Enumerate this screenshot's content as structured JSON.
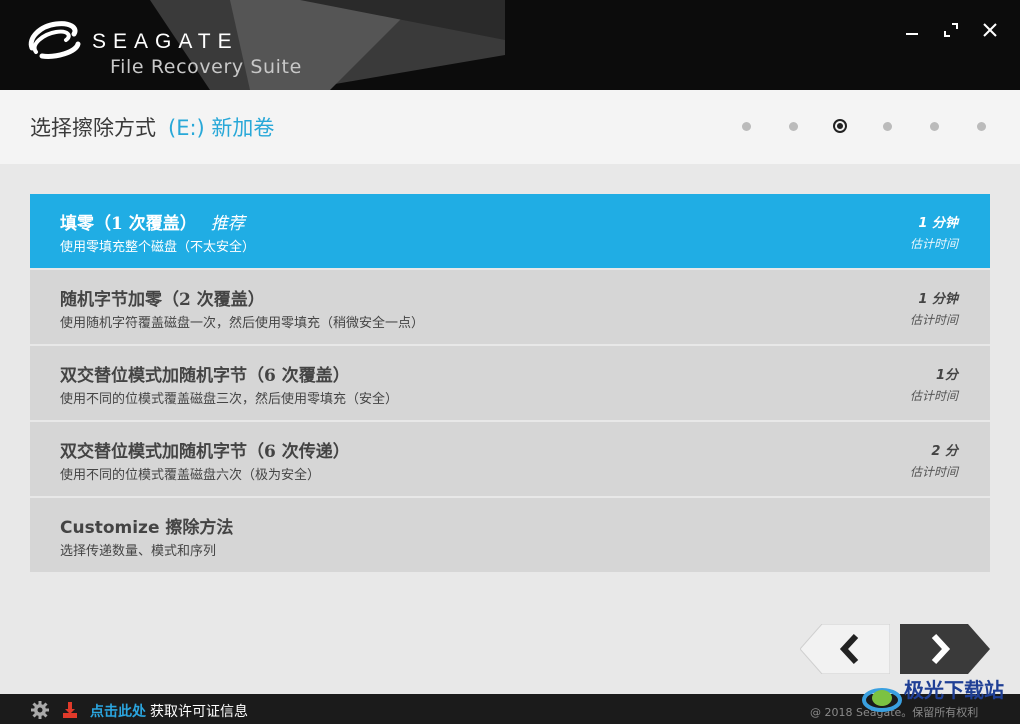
{
  "header": {
    "brand": "SEAGATE",
    "product": "File Recovery Suite"
  },
  "window_controls": [
    "minimize-icon",
    "maximize-icon",
    "close-icon"
  ],
  "stepbar": {
    "title": "选择擦除方式",
    "drive": "(E:) 新加卷",
    "steps_total": 6,
    "current_step": 3
  },
  "options": [
    {
      "title": "填零（1 次覆盖）",
      "tag": "推荐",
      "desc": "使用零填充整个磁盘（不太安全）",
      "time": "1 分钟",
      "time_label": "估计时间",
      "selected": true
    },
    {
      "title": "随机字节加零（2 次覆盖）",
      "tag": "",
      "desc": "使用随机字符覆盖磁盘一次，然后使用零填充（稍微安全一点）",
      "time": "1 分钟",
      "time_label": "估计时间",
      "selected": false
    },
    {
      "title": "双交替位模式加随机字节（6 次覆盖）",
      "tag": "",
      "desc": "使用不同的位模式覆盖磁盘三次，然后使用零填充（安全）",
      "time": "1分",
      "time_label": "估计时间",
      "selected": false
    },
    {
      "title": "双交替位模式加随机字节（6 次传递）",
      "tag": "",
      "desc": "使用不同的位模式覆盖磁盘六次（极为安全）",
      "time": "2 分",
      "time_label": "估计时间",
      "selected": false
    },
    {
      "title": "Customize 擦除方法",
      "tag": "",
      "desc": "选择传递数量、模式和序列",
      "time": "",
      "time_label": "",
      "selected": false
    }
  ],
  "footer": {
    "license_link": "点击此处",
    "license_text": "获取许可证信息",
    "copyright": "@ 2018 Seagate。保留所有权利"
  },
  "watermark": "极光下载站",
  "colors": {
    "accent": "#20ade4",
    "header_bg": "#0c0c0c",
    "option_bg": "#d6d6d6",
    "footer_bg": "#1b1b1b"
  }
}
